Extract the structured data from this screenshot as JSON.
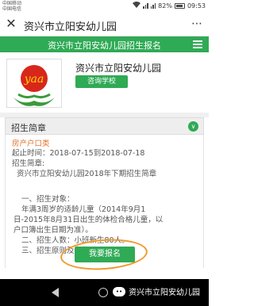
{
  "status": {
    "carrier1": "中国移动",
    "carrier2": "中国电信",
    "battery": "82%",
    "time": "09:53"
  },
  "window": {
    "close_icon": "close-icon",
    "title": "资兴市立阳安幼儿园",
    "more_icon": "more-icon"
  },
  "header": {
    "title": "资兴市立阳安幼儿园招生报名",
    "menu_icon": "menu-icon"
  },
  "school": {
    "name": "资兴市立阳安幼儿园",
    "consult_label": "咨询学校",
    "logo_text": "yaa"
  },
  "section": {
    "title": "招生简章",
    "toggle_icon": "chevron-down-icon"
  },
  "content": {
    "category": "房产户口类",
    "period": "起止时间：2018-07-15到2018-07-18",
    "brief_label": "招生简章:",
    "brief_title": "资兴市立阳安幼儿园2018年下期招生简章",
    "item1": "一、招生对象：",
    "item1_text1": "年满3周岁的适龄儿童（2014年9月1",
    "item1_text2": "日-2015年8月31日出生的体检合格儿童，以",
    "item1_text3": "户口簿出生日期为准）。",
    "item2": "二、招生人数：小班新生80人。",
    "item3": "三、招生原则及条件："
  },
  "signup": {
    "label": "我要报名"
  },
  "watermark": {
    "text": "资兴市立阳安幼儿园"
  },
  "colors": {
    "primary_green": "#2faa55",
    "category_orange": "#e0742a",
    "circle_orange": "#f09a2a"
  }
}
